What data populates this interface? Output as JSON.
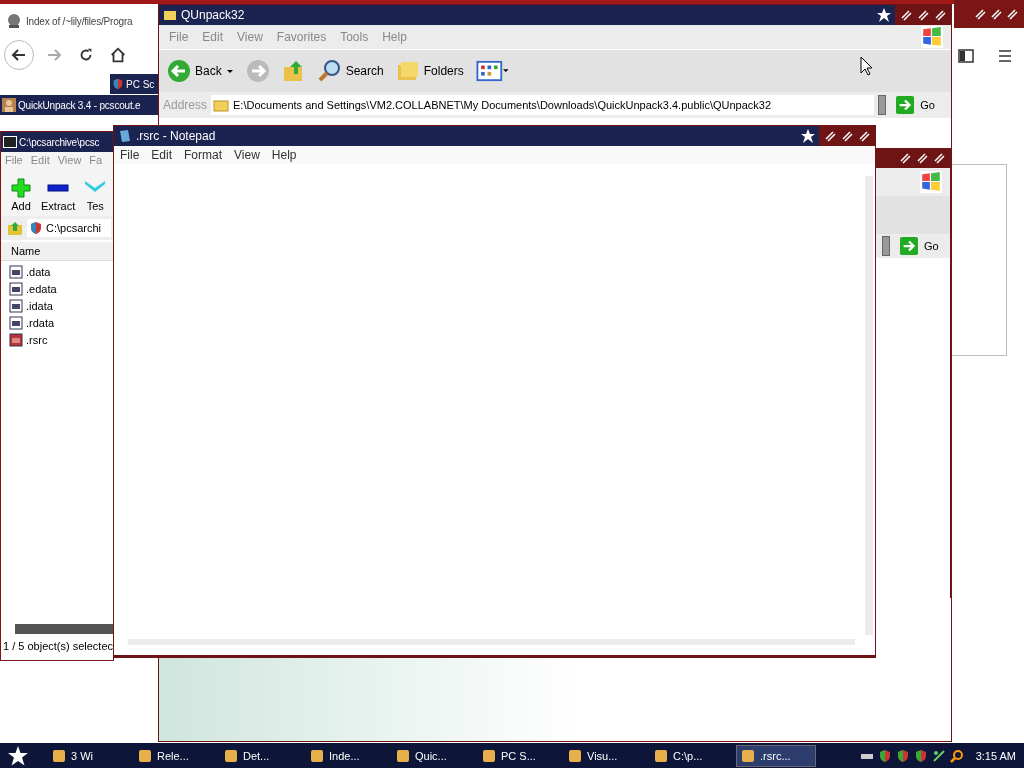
{
  "browser": {
    "tab_title": "Index of /~lily/files/Progra"
  },
  "pc_scout_window": {
    "title": "PC Sc"
  },
  "quickunpack_window": {
    "title": "QuickUnpack 3.4 - pcscout.e"
  },
  "archive_window": {
    "title": "C:\\pcsarchive\\pcsc",
    "menu": [
      "File",
      "Edit",
      "View",
      "Fa"
    ],
    "toolbar": [
      {
        "label": "Add",
        "kind": "add"
      },
      {
        "label": "Extract",
        "kind": "extract"
      },
      {
        "label": "Tes",
        "kind": "test"
      }
    ],
    "address": "C:\\pcsarchi",
    "column": "Name",
    "files": [
      {
        "name": ".data",
        "kind": "data"
      },
      {
        "name": ".edata",
        "kind": "data"
      },
      {
        "name": ".idata",
        "kind": "data"
      },
      {
        "name": ".rdata",
        "kind": "data"
      },
      {
        "name": ".rsrc",
        "kind": "resource"
      }
    ],
    "status": "1 / 5 object(s) selectec"
  },
  "explorer_window": {
    "title": "QUnpack32",
    "menu": [
      "File",
      "Edit",
      "View",
      "Favorites",
      "Tools",
      "Help"
    ],
    "back": "Back",
    "search": "Search",
    "folders": "Folders",
    "address_label": "Address",
    "address": "E:\\Documents and Settings\\VM2.COLLABNET\\My Documents\\Downloads\\QuickUnpack3.4.public\\QUnpack32",
    "go": "Go"
  },
  "second_explorer_window": {
    "go": "Go"
  },
  "notepad": {
    "title": ".rsrc - Notepad",
    "menu": [
      "File",
      "Edit",
      "Format",
      "View",
      "Help"
    ]
  },
  "taskbar": {
    "items": [
      {
        "label": "3 Wi",
        "selected": false
      },
      {
        "label": "Rele...",
        "selected": false
      },
      {
        "label": "Det...",
        "selected": false
      },
      {
        "label": "Inde...",
        "selected": false
      },
      {
        "label": "Quic...",
        "selected": false
      },
      {
        "label": "PC S...",
        "selected": false
      },
      {
        "label": "Visu...",
        "selected": false
      },
      {
        "label": "C:\\p...",
        "selected": false
      },
      {
        "label": ".rsrc...",
        "selected": true
      }
    ],
    "clock": "3:15 AM"
  }
}
